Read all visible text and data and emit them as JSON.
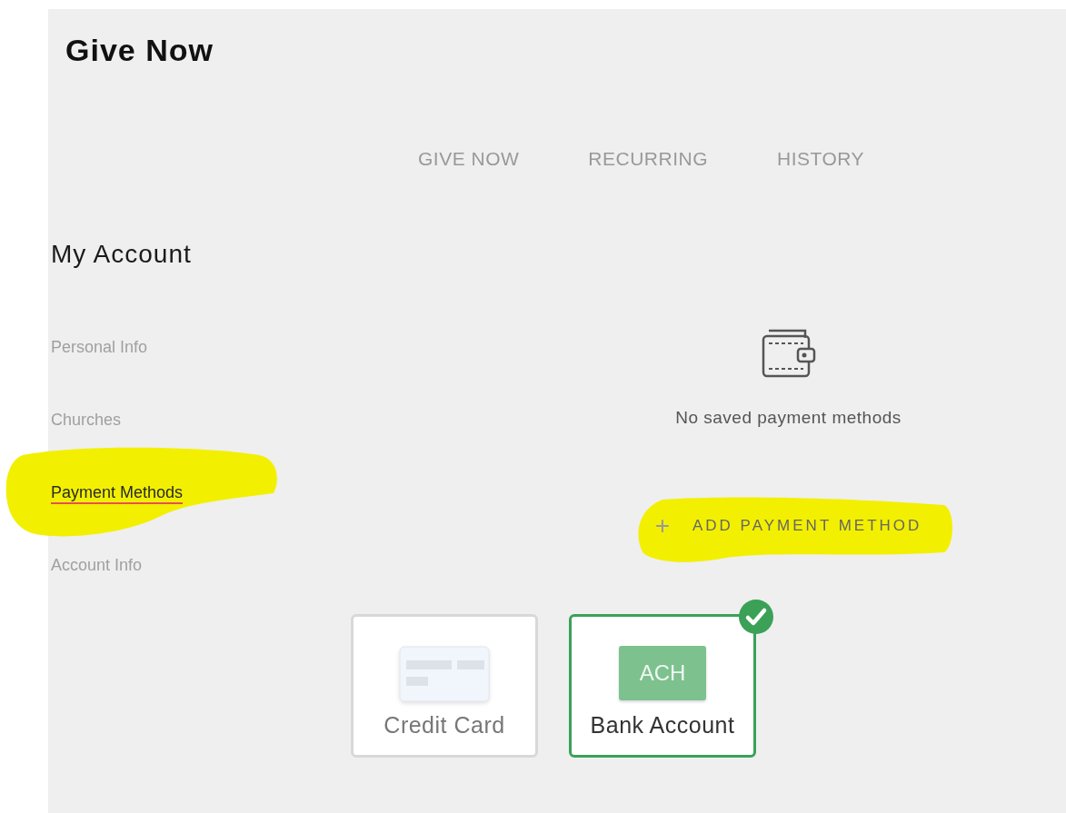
{
  "page": {
    "title": "Give Now"
  },
  "tabs": [
    {
      "label": "GIVE NOW",
      "selected": false
    },
    {
      "label": "RECURRING",
      "selected": false
    },
    {
      "label": "HISTORY",
      "selected": false
    }
  ],
  "sidebar": {
    "heading": "My Account",
    "items": [
      {
        "label": "Personal Info",
        "selected": false,
        "highlighted": false
      },
      {
        "label": "Churches",
        "selected": false,
        "highlighted": false
      },
      {
        "label": "Payment Methods",
        "selected": true,
        "highlighted": true
      },
      {
        "label": "Account Info",
        "selected": false,
        "highlighted": false
      }
    ]
  },
  "content": {
    "empty_message": "No saved payment methods",
    "add_button": {
      "icon": "+",
      "label": "ADD PAYMENT METHOD",
      "highlighted": true
    }
  },
  "payment_types": [
    {
      "kind": "card",
      "label": "Credit Card",
      "selected": false
    },
    {
      "kind": "ach",
      "badge": "ACH",
      "label": "Bank Account",
      "selected": true
    }
  ]
}
